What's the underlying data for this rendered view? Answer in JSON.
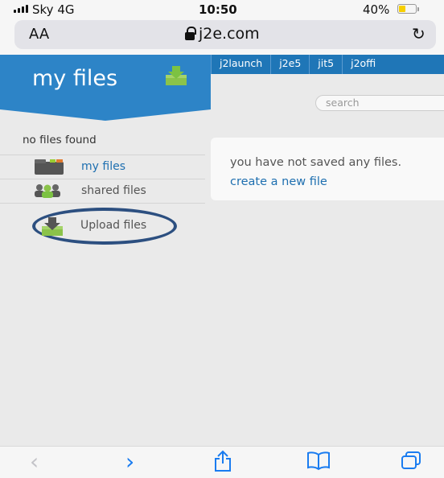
{
  "status": {
    "carrier": "Sky",
    "network": "4G",
    "time": "10:50",
    "battery": "40%",
    "battery_level": 0.4
  },
  "browser": {
    "text_size_label": "AA",
    "domain": "j2e.com"
  },
  "apps": [
    "j2launch",
    "j2e5",
    "jit5",
    "j2offi"
  ],
  "banner": {
    "title": "my files"
  },
  "search": {
    "placeholder": "search"
  },
  "sidebar": {
    "empty_text": "no files found",
    "items": [
      {
        "label": "my files"
      },
      {
        "label": "shared files"
      }
    ],
    "upload_label": "Upload files"
  },
  "main": {
    "message": "you have not saved any files.",
    "create_link": "create a new file"
  },
  "colors": {
    "brand": "#2d84c7",
    "link": "#1e6fb0",
    "annotation": "#2c4f80",
    "ios_blue": "#1a7cf0"
  }
}
